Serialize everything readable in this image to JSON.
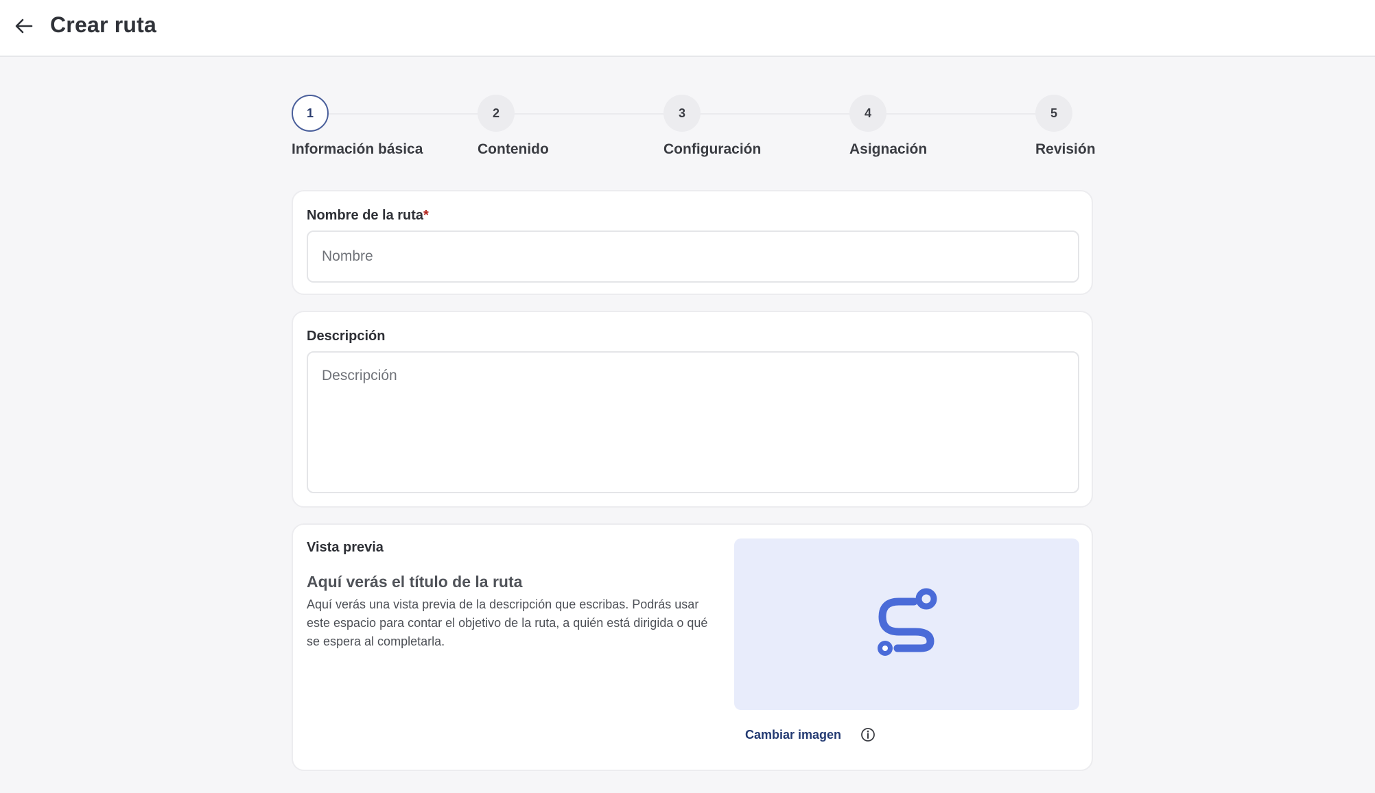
{
  "header": {
    "title": "Crear ruta",
    "back_icon": "arrow-left-icon"
  },
  "stepper": {
    "active_step": 1,
    "steps": [
      {
        "number": "1",
        "label": "Información básica"
      },
      {
        "number": "2",
        "label": "Contenido"
      },
      {
        "number": "3",
        "label": "Configuración"
      },
      {
        "number": "4",
        "label": "Asignación"
      },
      {
        "number": "5",
        "label": "Revisión"
      }
    ]
  },
  "name_field": {
    "label": "Nombre de la ruta",
    "required_mark": "*",
    "value": "",
    "placeholder": "Nombre"
  },
  "description_field": {
    "label": "Descripción",
    "value": "",
    "placeholder": "Descripción"
  },
  "preview": {
    "heading": "Vista previa",
    "title": "Aquí verás el título de la ruta",
    "description": "Aquí verás una vista previa de la descripción que escribas. Podrás usar este espacio para contar el objetivo de la ruta, a quién está dirigida o qué se espera al completarla.",
    "image_icon": "route-icon",
    "change_image_label": "Cambiar imagen",
    "info_icon": "info-icon"
  },
  "colors": {
    "accent": "#4a6bd8",
    "active_step_border": "#4a5f9b",
    "link": "#233a72",
    "required": "#b3261e",
    "preview_bg": "#e8ecfb"
  }
}
